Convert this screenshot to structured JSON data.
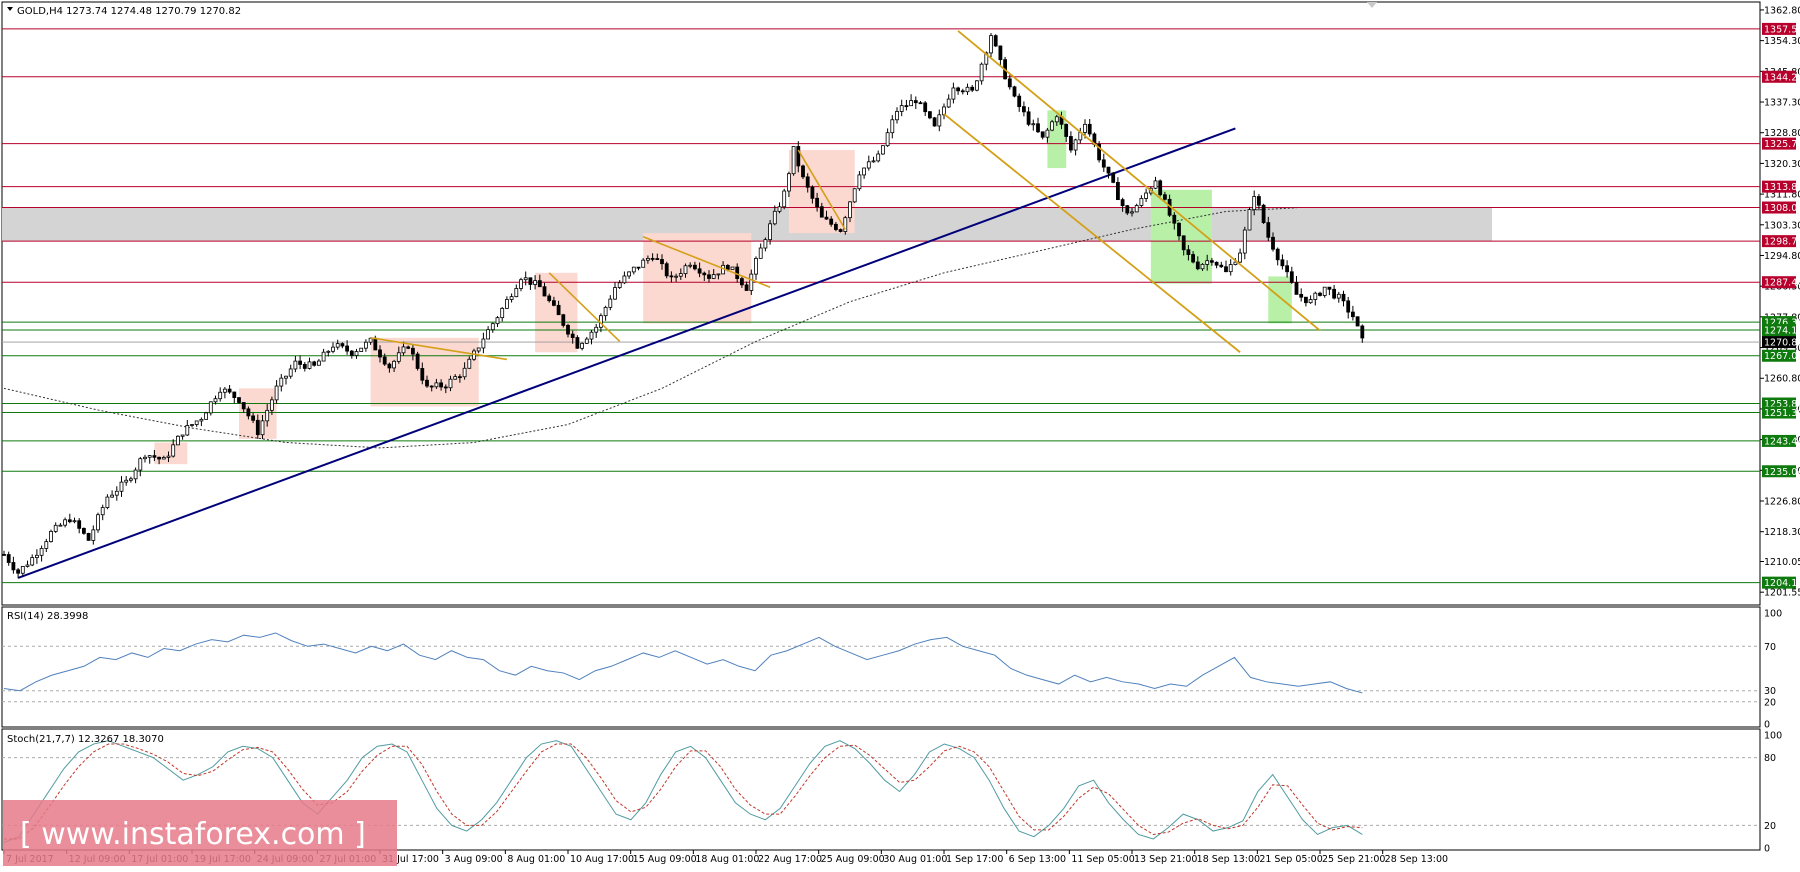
{
  "header": {
    "main": "GOLD,H4  1273.74 1274.48 1270.79 1270.82",
    "rsi": "RSI(14) 28.3998",
    "stoch": "Stoch(21,7,7) 12.3267 18.3070"
  },
  "watermark": "[ www.instaforex.com ]",
  "colors": {
    "resistance": "#b8002c",
    "support": "#0e7a0e",
    "current": "#000000",
    "trendline": "#00007a",
    "channel": "#d4a017",
    "ma": "#333333",
    "rsi": "#4f81bd",
    "stoch_main": "#4f9ba0",
    "stoch_signal": "#c0392b",
    "bull_zone": "#b8f0a8",
    "bear_zone": "#fbd8d0",
    "range_band": "#d4d4d4",
    "watermark_bg": "#e57a88"
  },
  "chart_data": [
    {
      "type": "candlestick",
      "title": "GOLD,H4",
      "symbol": "GOLD",
      "timeframe": "H4",
      "last_bar": {
        "open": 1273.74,
        "high": 1274.48,
        "low": 1270.79,
        "close": 1270.82
      },
      "ylim": [
        1198.0,
        1365.0
      ],
      "y_ticks": [
        1362.8,
        1354.3,
        1345.8,
        1337.3,
        1328.8,
        1320.3,
        1311.8,
        1303.3,
        1294.8,
        1286.3,
        1277.8,
        1269.3,
        1260.8,
        1252.3,
        1243.8,
        1235.3,
        1226.8,
        1218.3,
        1210.05,
        1201.55
      ],
      "y_tick_labels": [
        "1362.80",
        "1354.30",
        "1345.80",
        "1337.30",
        "1328.80",
        "1320.30",
        "1311.80",
        "1303.30",
        "1294.80",
        "1286.30",
        "1277.80",
        "1269.30",
        "1260.80",
        "1252.30",
        "1243.80",
        "1235.30",
        "1226.80",
        "1218.30",
        "1210.05",
        "1201.55"
      ],
      "x_ticks": [
        "7 Jul 2017",
        "12 Jul 09:00",
        "17 Jul 01:00",
        "19 Jul 17:00",
        "24 Jul 09:00",
        "27 Jul 01:00",
        "31 Jul 17:00",
        "3 Aug 09:00",
        "8 Aug 01:00",
        "10 Aug 17:00",
        "15 Aug 09:00",
        "18 Aug 01:00",
        "22 Aug 17:00",
        "25 Aug 09:00",
        "30 Aug 01:00",
        "1 Sep 17:00",
        "6 Sep 13:00",
        "11 Sep 05:00",
        "13 Sep 21:00",
        "18 Sep 13:00",
        "21 Sep 05:00",
        "25 Sep 21:00",
        "28 Sep 13:00"
      ],
      "price_path": [
        [
          0,
          1212
        ],
        [
          3,
          1207
        ],
        [
          6,
          1211
        ],
        [
          10,
          1218
        ],
        [
          14,
          1222
        ],
        [
          18,
          1216
        ],
        [
          22,
          1228
        ],
        [
          26,
          1232
        ],
        [
          30,
          1240
        ],
        [
          34,
          1238
        ],
        [
          38,
          1246
        ],
        [
          42,
          1250
        ],
        [
          46,
          1258
        ],
        [
          50,
          1255
        ],
        [
          54,
          1246
        ],
        [
          58,
          1258
        ],
        [
          62,
          1265
        ],
        [
          66,
          1264
        ],
        [
          70,
          1270
        ],
        [
          74,
          1268
        ],
        [
          78,
          1271
        ],
        [
          82,
          1264
        ],
        [
          86,
          1270
        ],
        [
          90,
          1258
        ],
        [
          94,
          1259
        ],
        [
          98,
          1263
        ],
        [
          102,
          1272
        ],
        [
          106,
          1280
        ],
        [
          110,
          1289
        ],
        [
          114,
          1286
        ],
        [
          118,
          1278
        ],
        [
          122,
          1270
        ],
        [
          126,
          1275
        ],
        [
          130,
          1286
        ],
        [
          134,
          1291
        ],
        [
          138,
          1295
        ],
        [
          142,
          1288
        ],
        [
          146,
          1293
        ],
        [
          150,
          1289
        ],
        [
          154,
          1292
        ],
        [
          158,
          1286
        ],
        [
          162,
          1300
        ],
        [
          166,
          1312
        ],
        [
          168,
          1324
        ],
        [
          170,
          1316
        ],
        [
          174,
          1305
        ],
        [
          178,
          1302
        ],
        [
          182,
          1318
        ],
        [
          186,
          1322
        ],
        [
          190,
          1335
        ],
        [
          194,
          1338
        ],
        [
          198,
          1330
        ],
        [
          202,
          1342
        ],
        [
          206,
          1340
        ],
        [
          208,
          1348
        ],
        [
          210,
          1356
        ],
        [
          212,
          1348
        ],
        [
          215,
          1338
        ],
        [
          218,
          1332
        ],
        [
          221,
          1327
        ],
        [
          224,
          1334
        ],
        [
          227,
          1324
        ],
        [
          230,
          1332
        ],
        [
          233,
          1322
        ],
        [
          236,
          1314
        ],
        [
          239,
          1306
        ],
        [
          242,
          1310
        ],
        [
          245,
          1316
        ],
        [
          248,
          1306
        ],
        [
          251,
          1296
        ],
        [
          254,
          1292
        ],
        [
          257,
          1294
        ],
        [
          260,
          1290
        ],
        [
          263,
          1296
        ],
        [
          266,
          1312
        ],
        [
          269,
          1300
        ],
        [
          272,
          1292
        ],
        [
          275,
          1284
        ],
        [
          278,
          1282
        ],
        [
          281,
          1286
        ],
        [
          284,
          1283
        ],
        [
          287,
          1278
        ],
        [
          289,
          1271
        ]
      ],
      "levels": {
        "resistance": [
          1357.55,
          1344.29,
          1325.78,
          1313.86,
          1308.08,
          1298.77,
          1287.4
        ],
        "support": [
          1276.35,
          1274.15,
          1267.03,
          1253.8,
          1251.3,
          1243.44,
          1235.04,
          1204.19
        ],
        "current": 1270.82
      },
      "level_labels": {
        "resistance": [
          "1357.55",
          "1344.29",
          "1325.78",
          "1313.86",
          "1308.08",
          "1298.77",
          "1287.40"
        ],
        "support": [
          "1276.35",
          "1274.15",
          "1267.03",
          "1253.80",
          "1251.30",
          "1243.44",
          "1235.04",
          "1204.19"
        ],
        "current": "1270.82"
      },
      "range_band": [
        1298.77,
        1308.08
      ],
      "trendline": [
        [
          3,
          1205.5
        ],
        [
          262,
          1330
        ]
      ],
      "ma_path": [
        [
          0,
          1258
        ],
        [
          20,
          1252
        ],
        [
          40,
          1247
        ],
        [
          60,
          1243
        ],
        [
          80,
          1241.5
        ],
        [
          100,
          1243
        ],
        [
          120,
          1248
        ],
        [
          140,
          1258
        ],
        [
          160,
          1271
        ],
        [
          180,
          1282
        ],
        [
          200,
          1290
        ],
        [
          220,
          1296
        ],
        [
          240,
          1302
        ],
        [
          260,
          1307
        ],
        [
          275,
          1308
        ]
      ],
      "channel_lines": [
        [
          [
            203,
            1357
          ],
          [
            280,
            1274
          ]
        ],
        [
          [
            200,
            1334
          ],
          [
            263,
            1268
          ]
        ]
      ],
      "flags": [
        [
          [
            78,
            1272
          ],
          [
            107,
            1266
          ]
        ],
        [
          [
            116,
            1290
          ],
          [
            131,
            1271
          ]
        ],
        [
          [
            136,
            1300
          ],
          [
            163,
            1286
          ]
        ],
        [
          [
            169,
            1324
          ],
          [
            179,
            1302
          ]
        ]
      ],
      "bear_zones": [
        [
          32,
          39,
          1237,
          1243
        ],
        [
          50,
          58,
          1244,
          1258
        ],
        [
          78,
          101,
          1253,
          1272
        ],
        [
          113,
          122,
          1268,
          1290
        ],
        [
          136,
          159,
          1276,
          1301
        ],
        [
          167,
          181,
          1301,
          1324
        ]
      ],
      "bull_zones": [
        [
          222,
          226,
          1319,
          1335
        ],
        [
          244,
          257,
          1287,
          1313
        ],
        [
          269,
          274,
          1276,
          1289
        ]
      ]
    },
    {
      "type": "line",
      "title": "RSI(14) 28.3998",
      "series": [
        {
          "name": "RSI(14)",
          "values": [
            32,
            30,
            38,
            44,
            48,
            52,
            60,
            58,
            64,
            60,
            68,
            66,
            72,
            76,
            74,
            80,
            78,
            82,
            75,
            70,
            72,
            68,
            64,
            70,
            66,
            72,
            62,
            58,
            66,
            60,
            58,
            48,
            44,
            52,
            48,
            46,
            40,
            48,
            52,
            58,
            64,
            60,
            66,
            60,
            54,
            58,
            52,
            48,
            62,
            66,
            72,
            78,
            70,
            64,
            58,
            62,
            66,
            72,
            76,
            78,
            70,
            66,
            62,
            50,
            44,
            40,
            36,
            44,
            38,
            42,
            38,
            36,
            32,
            36,
            34,
            44,
            52,
            60,
            42,
            38,
            36,
            34,
            36,
            38,
            32,
            28
          ]
        }
      ],
      "ylim": [
        0,
        100
      ],
      "y_ticks": [
        100,
        70,
        30,
        20,
        0
      ],
      "levels": [
        70,
        30,
        20
      ]
    },
    {
      "type": "line",
      "title": "Stoch(21,7,7) 12.3267 18.3070",
      "series": [
        {
          "name": "Stoch(21,7,7)",
          "values": [
            5,
            10,
            30,
            50,
            70,
            85,
            92,
            95,
            90,
            85,
            80,
            70,
            60,
            65,
            72,
            85,
            90,
            88,
            80,
            60,
            40,
            30,
            45,
            60,
            80,
            90,
            92,
            85,
            60,
            35,
            20,
            15,
            25,
            40,
            60,
            80,
            92,
            95,
            90,
            70,
            50,
            30,
            25,
            40,
            65,
            85,
            90,
            80,
            60,
            40,
            30,
            25,
            35,
            55,
            75,
            90,
            95,
            88,
            75,
            60,
            50,
            65,
            85,
            92,
            88,
            80,
            60,
            35,
            15,
            10,
            20,
            35,
            55,
            60,
            40,
            25,
            12,
            8,
            18,
            30,
            25,
            15,
            18,
            24,
            50,
            65,
            45,
            25,
            12,
            18,
            20,
            12
          ]
        },
        {
          "name": "signal",
          "values": [
            8,
            8,
            18,
            36,
            55,
            72,
            85,
            92,
            92,
            88,
            83,
            76,
            66,
            64,
            68,
            78,
            87,
            89,
            85,
            70,
            52,
            38,
            40,
            50,
            68,
            82,
            90,
            90,
            74,
            50,
            30,
            20,
            20,
            32,
            50,
            68,
            85,
            92,
            92,
            80,
            62,
            42,
            32,
            36,
            52,
            72,
            86,
            86,
            72,
            52,
            38,
            30,
            30,
            46,
            64,
            80,
            90,
            91,
            82,
            70,
            58,
            60,
            72,
            86,
            90,
            85,
            72,
            50,
            28,
            16,
            16,
            28,
            44,
            54,
            48,
            34,
            20,
            12,
            14,
            22,
            26,
            20,
            17,
            20,
            36,
            56,
            55,
            38,
            22,
            16,
            19,
            18
          ]
        }
      ],
      "ylim": [
        0,
        100
      ],
      "y_ticks": [
        100,
        80,
        20,
        0
      ],
      "levels": [
        80,
        20
      ]
    }
  ]
}
